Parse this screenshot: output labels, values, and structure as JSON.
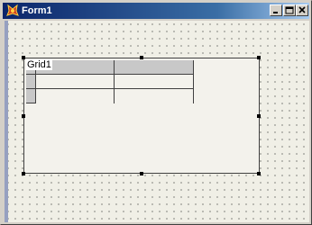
{
  "window": {
    "title": "Form1"
  },
  "grid": {
    "name": "Grid1"
  },
  "icons": {
    "app": "delphi-app-icon",
    "minimize": "minimize-icon",
    "maximize": "maximize-icon",
    "close": "close-icon"
  },
  "colors": {
    "titlebar_start": "#0a246a",
    "titlebar_end": "#a6caf0",
    "form_surface": "#f0efe6",
    "grid_header": "#c8c8c8"
  }
}
